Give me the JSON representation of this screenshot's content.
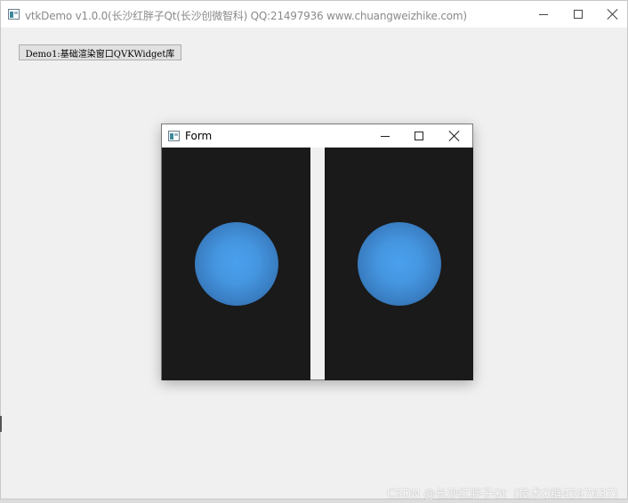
{
  "main_window": {
    "title": "vtkDemo v1.0.0(长沙红胖子Qt(长沙创微智科) QQ:21497936 www.chuangweizhike.com)",
    "buttons": {
      "minimize_icon": "minimize-icon",
      "maximize_icon": "maximize-icon",
      "close_icon": "close-icon"
    }
  },
  "demo_button": {
    "label": "Demo1:基础渲染窗口QVKWidget库"
  },
  "form_window": {
    "title": "Form",
    "views": [
      {
        "content": "sphere",
        "sphere_color": "#4596e0",
        "background": "#1a1a1a"
      },
      {
        "content": "sphere",
        "sphere_color": "#4596e0",
        "background": "#1a1a1a"
      }
    ]
  },
  "watermark": "CSDN @长沙红胖子Qt（技术Q群4597637）",
  "colors": {
    "window_bg": "#f0f0f0",
    "titlebar_bg": "#ffffff",
    "render_bg": "#1a1a1a",
    "sphere": "#4596e0"
  }
}
